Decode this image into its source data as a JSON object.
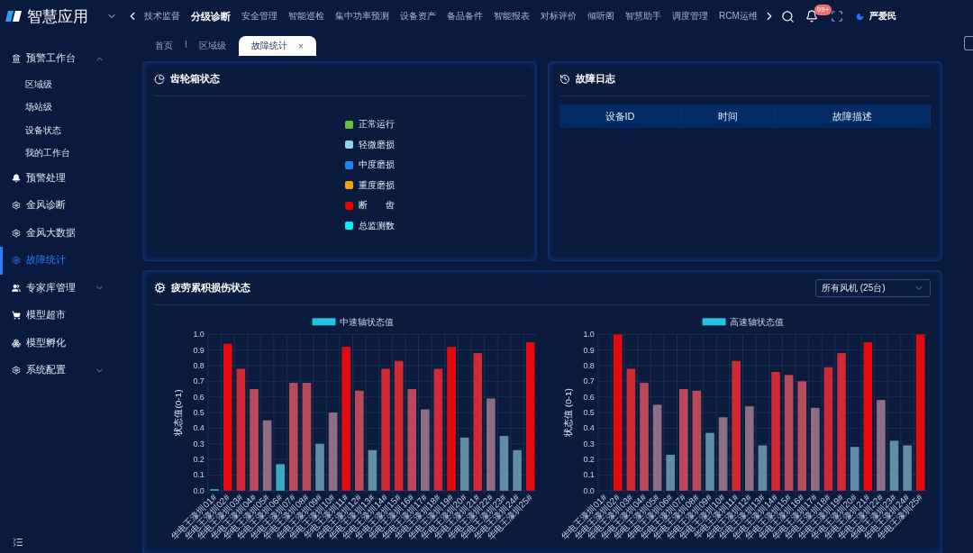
{
  "app": {
    "title": "智慧应用"
  },
  "top_nav": [
    {
      "label": "技术监督",
      "selected": false
    },
    {
      "label": "分级诊断",
      "selected": true
    },
    {
      "label": "安全管理",
      "selected": false
    },
    {
      "label": "智能巡检",
      "selected": false
    },
    {
      "label": "集中功率预测",
      "selected": false
    },
    {
      "label": "设备资产",
      "selected": false
    },
    {
      "label": "备品备件",
      "selected": false
    },
    {
      "label": "智能报表",
      "selected": false
    },
    {
      "label": "对标评价",
      "selected": false
    },
    {
      "label": "倾听阁",
      "selected": false
    },
    {
      "label": "智慧助手",
      "selected": false
    },
    {
      "label": "调度管理",
      "selected": false
    },
    {
      "label": "RCM运维",
      "selected": false
    }
  ],
  "notifications": {
    "badge": "99+"
  },
  "user": {
    "name": "严爱民"
  },
  "sidebar": {
    "items": [
      {
        "label": "预警工作台",
        "kind": "group",
        "expanded": true,
        "selected": false,
        "children": [
          {
            "label": "区域级",
            "selected": false
          },
          {
            "label": "场站级",
            "selected": false
          },
          {
            "label": "设备状态",
            "selected": false
          },
          {
            "label": "我的工作台",
            "selected": false
          }
        ]
      },
      {
        "label": "预警处理",
        "kind": "link",
        "selected": false
      },
      {
        "label": "金风诊断",
        "kind": "link",
        "selected": false
      },
      {
        "label": "金风大数据",
        "kind": "link",
        "selected": false
      },
      {
        "label": "故障统计",
        "kind": "link",
        "selected": true
      },
      {
        "label": "专家库管理",
        "kind": "group",
        "expanded": false,
        "selected": false
      },
      {
        "label": "模型超市",
        "kind": "link",
        "selected": false
      },
      {
        "label": "模型孵化",
        "kind": "link",
        "selected": false
      },
      {
        "label": "系统配置",
        "kind": "group",
        "expanded": false,
        "selected": false
      }
    ]
  },
  "breadcrumb_tabs": [
    {
      "label": "首页",
      "selected": false
    },
    {
      "label": "区域级",
      "selected": false
    },
    {
      "label": "故障统计",
      "selected": true,
      "close": "×"
    }
  ],
  "gearbox_panel": {
    "title": "齿轮箱状态",
    "legend": [
      {
        "label": "正常运行",
        "color": "#67c23a"
      },
      {
        "label": "轻微磨损",
        "color": "#8fd3f4"
      },
      {
        "label": "中度磨损",
        "color": "#1e88f0"
      },
      {
        "label": "重度磨损",
        "color": "#f5a10a"
      },
      {
        "label": "断　　齿",
        "color": "#f00000"
      },
      {
        "label": "总监测数",
        "color": "#00f0f5"
      }
    ]
  },
  "fault_log_panel": {
    "title": "故障日志",
    "table": {
      "columns": [
        "设备ID",
        "时间",
        "故障描述"
      ]
    }
  },
  "fatigue_panel": {
    "title": "疲劳累积损伤状态",
    "filter": {
      "value": "所有风机 (25台)"
    },
    "charts": [
      {
        "chart_data": {
          "type": "bar",
          "grid": true,
          "ylabel": "状态值(0-1)",
          "ylim": [
            0,
            1
          ],
          "yticks": [
            {
              "value": 0,
              "label": "0.0"
            },
            {
              "value": 0.1,
              "label": "0.1"
            },
            {
              "value": 0.2,
              "label": "0.2"
            },
            {
              "value": 0.3,
              "label": "0.3"
            },
            {
              "value": 0.4,
              "label": "0.4"
            },
            {
              "value": 0.5,
              "label": "0.5"
            },
            {
              "value": 0.6,
              "label": "0.6"
            },
            {
              "value": 0.7,
              "label": "0.7"
            },
            {
              "value": 0.8,
              "label": "0.8"
            },
            {
              "value": 0.9,
              "label": "0.9"
            },
            {
              "value": 1,
              "label": "1.0"
            }
          ],
          "categories": [
            "华电王濠圳01#",
            "华电王濠圳02#",
            "华电王濠圳03#",
            "华电王濠圳04#",
            "华电王濠圳05#",
            "华电王濠圳06#",
            "华电王濠圳07#",
            "华电王濠圳08#",
            "华电王濠圳09#",
            "华电王濠圳10#",
            "华电王濠圳11#",
            "华电王濠圳12#",
            "华电王濠圳13#",
            "华电王濠圳14#",
            "华电王濠圳15#",
            "华电王濠圳16#",
            "华电王濠圳17#",
            "华电王濠圳18#",
            "华电王濠圳19#",
            "华电王濠圳20#",
            "华电王濠圳21#",
            "华电王濠圳22#",
            "华电王濠圳23#",
            "华电王濠圳24#",
            "华电王濠圳25#"
          ],
          "series": [
            {
              "name": "中速轴状态值",
              "color": "#22c5e0",
              "colors": [
                "#3aa9c4",
                "#e60a0e",
                "#d02a34",
                "#b84a5a",
                "#8f6d82",
                "#3aa9c4",
                "#b84a5a",
                "#b84a5a",
                "#5f8ea6",
                "#8f6d82",
                "#e60a0e",
                "#b84a5a",
                "#5f8ea6",
                "#d02a34",
                "#d02a34",
                "#b84a5a",
                "#8f6d82",
                "#d02a34",
                "#e60a0e",
                "#5f8ea6",
                "#d02a34",
                "#8f6d82",
                "#5f8ea6",
                "#5f8ea6",
                "#e60a0e"
              ],
              "values": [
                0.01,
                0.94,
                0.78,
                0.65,
                0.45,
                0.17,
                0.69,
                0.69,
                0.3,
                0.5,
                0.92,
                0.64,
                0.26,
                0.78,
                0.83,
                0.65,
                0.52,
                0.78,
                0.92,
                0.34,
                0.88,
                0.59,
                0.35,
                0.26,
                0.95
              ]
            }
          ]
        }
      },
      {
        "chart_data": {
          "type": "bar",
          "grid": true,
          "ylabel": "状态值 (0-1)",
          "ylim": [
            0,
            1
          ],
          "yticks": [
            {
              "value": 0,
              "label": "0.0"
            },
            {
              "value": 0.1,
              "label": "0.1"
            },
            {
              "value": 0.2,
              "label": "0.2"
            },
            {
              "value": 0.3,
              "label": "0.3"
            },
            {
              "value": 0.4,
              "label": "0.4"
            },
            {
              "value": 0.5,
              "label": "0.5"
            },
            {
              "value": 0.6,
              "label": "0.6"
            },
            {
              "value": 0.7,
              "label": "0.7"
            },
            {
              "value": 0.8,
              "label": "0.8"
            },
            {
              "value": 0.9,
              "label": "0.9"
            },
            {
              "value": 1,
              "label": "1.0"
            }
          ],
          "categories": [
            "华电王濠圳01#",
            "华电王濠圳02#",
            "华电王濠圳03#",
            "华电王濠圳04#",
            "华电王濠圳05#",
            "华电王濠圳06#",
            "华电王濠圳07#",
            "华电王濠圳08#",
            "华电王濠圳09#",
            "华电王濠圳10#",
            "华电王濠圳11#",
            "华电王濠圳12#",
            "华电王濠圳13#",
            "华电王濠圳14#",
            "华电王濠圳15#",
            "华电王濠圳16#",
            "华电王濠圳17#",
            "华电王濠圳18#",
            "华电王濠圳19#",
            "华电王濠圳20#",
            "华电王濠圳21#",
            "华电王濠圳22#",
            "华电王濠圳23#",
            "华电王濠圳24#",
            "华电王濠圳25#"
          ],
          "series": [
            {
              "name": "高速轴状态值",
              "color": "#22c5e0",
              "colors": [
                null,
                "#e60a0e",
                "#d02a34",
                "#b84a5a",
                "#8f6d82",
                "#5f8ea6",
                "#b84a5a",
                "#b84a5a",
                "#5f8ea6",
                "#8f6d82",
                "#d02a34",
                "#8f6d82",
                "#5f8ea6",
                "#d02a34",
                "#b84a5a",
                "#b84a5a",
                "#8f6d82",
                "#d02a34",
                "#d02a34",
                "#5f8ea6",
                "#e60a0e",
                "#8f6d82",
                "#5f8ea6",
                "#5f8ea6",
                "#e60a0e"
              ],
              "values": [
                0,
                1,
                0.78,
                0.69,
                0.55,
                0.23,
                0.65,
                0.64,
                0.37,
                0.47,
                0.83,
                0.54,
                0.29,
                0.76,
                0.74,
                0.7,
                0.53,
                0.79,
                0.88,
                0.28,
                0.95,
                0.58,
                0.32,
                0.29,
                1
              ]
            }
          ]
        }
      }
    ]
  }
}
